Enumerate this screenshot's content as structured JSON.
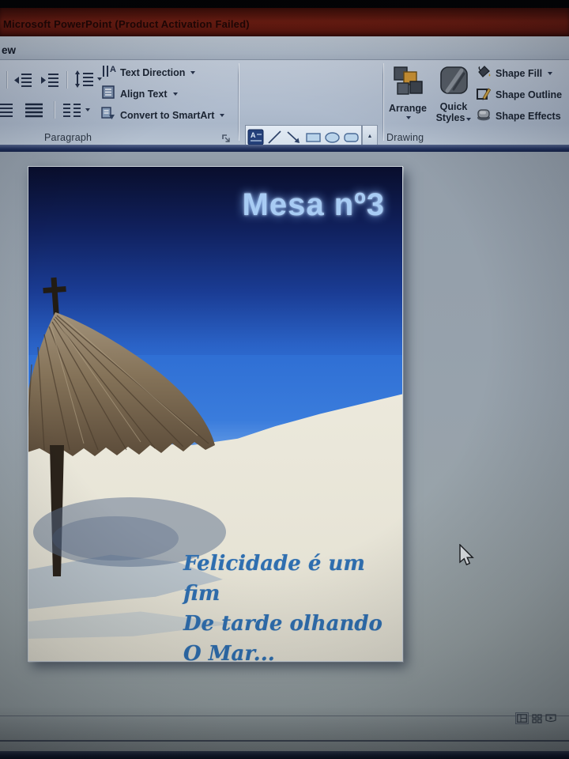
{
  "window": {
    "title": "Microsoft PowerPoint (Product Activation Failed)"
  },
  "ribbon": {
    "partial_tab": "ew",
    "paragraph": {
      "label": "Paragraph",
      "text_direction": "Text Direction",
      "align_text": "Align Text",
      "convert_to_smartart": "Convert to SmartArt"
    },
    "drawing": {
      "label": "Drawing",
      "arrange": "Arrange",
      "quick": "Quick",
      "styles": "Styles",
      "shape_fill": "Shape Fill",
      "shape_outline": "Shape Outline",
      "shape_effects": "Shape Effects"
    }
  },
  "slide": {
    "title": "Mesa nº3",
    "caption": [
      "Felicidade é um fim",
      "De tarde olhando",
      "O Mar..."
    ]
  },
  "colors": {
    "titlebar": "#7a1f12",
    "ribbon_bg": "#b4c0d0",
    "workspace": "#96a0aa",
    "sky_top": "#090e2c",
    "sea": "#2f6fd4",
    "sand": "#eae7da",
    "slide_title_text": "#a8ccf4",
    "caption_text": "#2f6fb0"
  }
}
